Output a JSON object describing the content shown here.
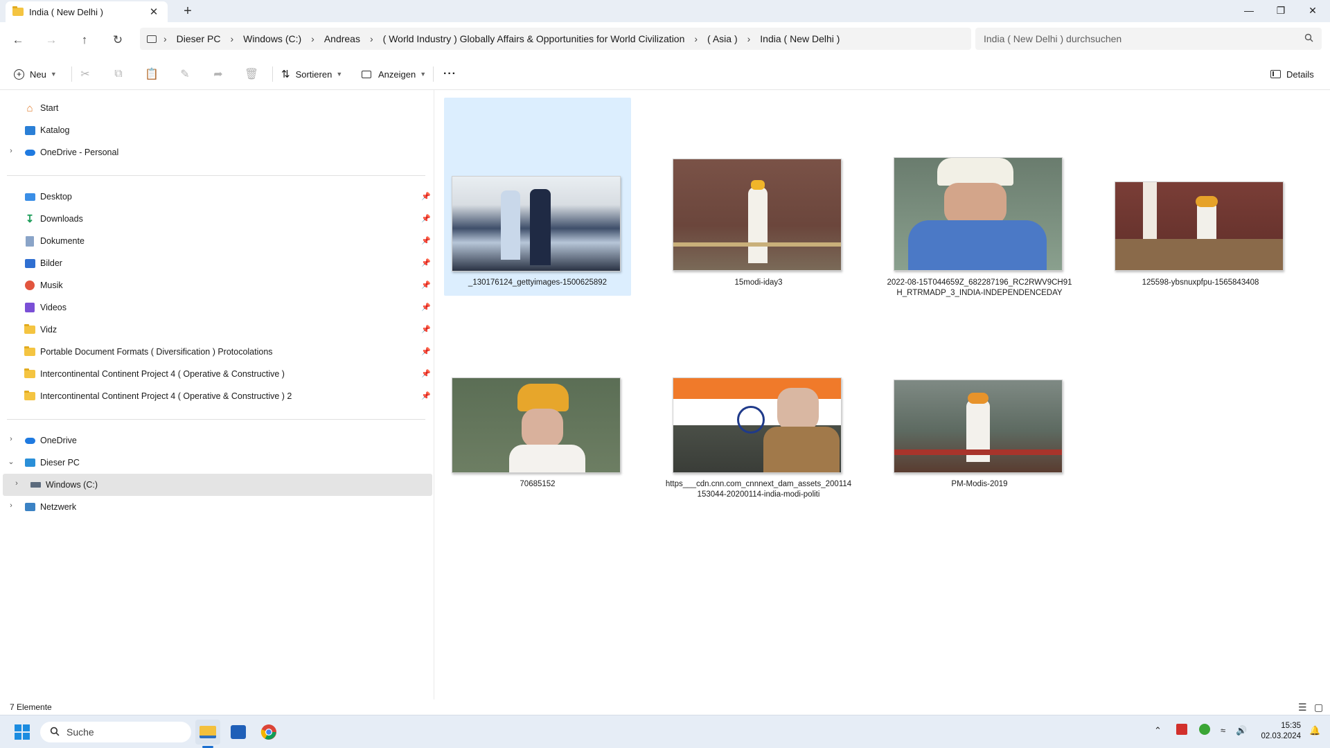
{
  "window": {
    "tab_title": "India ( New Delhi )",
    "new_tab": "+",
    "close_tab": "✕"
  },
  "address": {
    "crumbs": [
      "Dieser PC",
      "Windows (C:)",
      "Andreas",
      "( World Industry ) Globally Affairs & Opportunities for World Civilization",
      "( Asia )",
      "India ( New Delhi )"
    ],
    "search_placeholder": "India ( New Delhi ) durchsuchen"
  },
  "toolbar": {
    "new_label": "Neu",
    "sort_label": "Sortieren",
    "view_label": "Anzeigen",
    "more_label": "···",
    "details_label": "Details"
  },
  "sidebar": {
    "top": [
      {
        "label": "Start",
        "icon": "home-icon"
      },
      {
        "label": "Katalog",
        "icon": "gallery-icon"
      },
      {
        "label": "OneDrive - Personal",
        "icon": "cloud-icon"
      }
    ],
    "quick": [
      {
        "label": "Desktop",
        "icon": "desktop-icon"
      },
      {
        "label": "Downloads",
        "icon": "download-icon"
      },
      {
        "label": "Dokumente",
        "icon": "documents-icon"
      },
      {
        "label": "Bilder",
        "icon": "pictures-icon"
      },
      {
        "label": "Musik",
        "icon": "music-icon"
      },
      {
        "label": "Videos",
        "icon": "videos-icon"
      },
      {
        "label": "Vidz",
        "icon": "folder-icon"
      },
      {
        "label": "Portable Document Formats ( Diversification ) Protocolations",
        "icon": "folder-icon"
      },
      {
        "label": "Intercontinental Continent Project 4 ( Operative & Constructive )",
        "icon": "folder-icon"
      },
      {
        "label": "Intercontinental Continent Project 4 ( Operative & Constructive ) 2",
        "icon": "folder-icon"
      }
    ],
    "tree": [
      {
        "label": "OneDrive",
        "icon": "cloud-icon"
      },
      {
        "label": "Dieser PC",
        "icon": "pc-icon"
      },
      {
        "label": "Windows (C:)",
        "icon": "drive-icon"
      },
      {
        "label": "Netzwerk",
        "icon": "network-icon"
      }
    ]
  },
  "files": [
    {
      "name": "_130176124_gettyimages-1500625892"
    },
    {
      "name": "15modi-iday3"
    },
    {
      "name": "2022-08-15T044659Z_682287196_RC2RWV9CH91H_RTRMADP_3_INDIA-INDEPENDENCEDAY"
    },
    {
      "name": "125598-ybsnuxpfpu-1565843408"
    },
    {
      "name": "70685152"
    },
    {
      "name": "https___cdn.cnn.com_cnnnext_dam_assets_200114153044-20200114-india-modi-politi"
    },
    {
      "name": "PM-Modis-2019"
    }
  ],
  "status": {
    "count": "7 Elemente"
  },
  "taskbar": {
    "search_label": "Suche",
    "time": "15:35",
    "date": "02.03.2024"
  }
}
